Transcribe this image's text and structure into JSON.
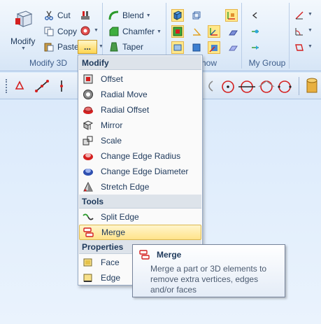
{
  "ribbon": {
    "modify_label": "Modify",
    "cut_label": "Cut",
    "copy_label": "Copy",
    "paste_label": "Paste",
    "more_label": "...",
    "blend_label": "Blend",
    "chamfer_label": "Chamfer",
    "taper_label": "Taper",
    "groups": {
      "modify3d": "Modify 3D",
      "show": "how",
      "mygroup": "My Group"
    }
  },
  "menu": {
    "sections": {
      "modify": "Modify",
      "tools": "Tools",
      "properties": "Properties"
    },
    "items": {
      "offset": "Offset",
      "radial_move": "Radial Move",
      "radial_offset": "Radial Offset",
      "mirror": "Mirror",
      "scale": "Scale",
      "change_edge_radius": "Change Edge Radius",
      "change_edge_diameter": "Change Edge Diameter",
      "stretch_edge": "Stretch Edge",
      "split_edge": "Split Edge",
      "merge": "Merge",
      "face": "Face",
      "edge": "Edge"
    }
  },
  "tooltip": {
    "title": "Merge",
    "description": "Merge a part or 3D elements to remove extra vertices, edges and/or faces"
  },
  "colors": {
    "accent_red": "#d42020",
    "highlight": "#ffe38a",
    "ribbon_text": "#1e395b"
  }
}
